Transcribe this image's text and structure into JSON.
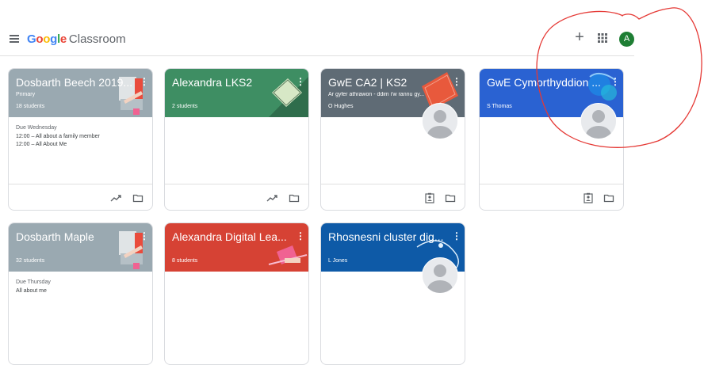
{
  "header": {
    "logo_google": "Google",
    "logo_classroom": "Classroom",
    "avatar_letter": "A",
    "plus_symbol": "+"
  },
  "colors": {
    "grey": "#9aa9b1",
    "green": "#3e8e63",
    "slate": "#5f6b75",
    "blue": "#2a62d2",
    "red": "#d64234",
    "navy": "#0e5aa7",
    "annotation": "#e53935"
  },
  "cards": [
    {
      "title": "Dosbarth Beech 2019...",
      "section": "Primary",
      "meta": "18 students",
      "due": "Due Wednesday",
      "items": [
        "12:00 – All about a family member",
        "12:00 – All About Me"
      ],
      "footer_icons": [
        "trending-up-icon",
        "folder-icon"
      ]
    },
    {
      "title": "Alexandra LKS2",
      "meta": "2 students",
      "footer_icons": [
        "trending-up-icon",
        "folder-icon"
      ]
    },
    {
      "title": "GwE CA2 | KS2",
      "section": "Ar gyfer athrawon - ddim i'w rannu gy...",
      "meta": "O Hughes",
      "footer_icons": [
        "assignment-ind-icon",
        "folder-icon"
      ]
    },
    {
      "title": "GwE Cymorthyddion ...",
      "meta": "S Thomas",
      "footer_icons": [
        "assignment-ind-icon",
        "folder-icon"
      ]
    },
    {
      "title": "Dosbarth Maple",
      "meta": "32 students",
      "due": "Due Thursday",
      "items": [
        "All about me"
      ]
    },
    {
      "title": "Alexandra Digital Lea...",
      "meta": "8 students"
    },
    {
      "title": "Rhosnesni cluster dig...",
      "meta": "L Jones"
    }
  ]
}
